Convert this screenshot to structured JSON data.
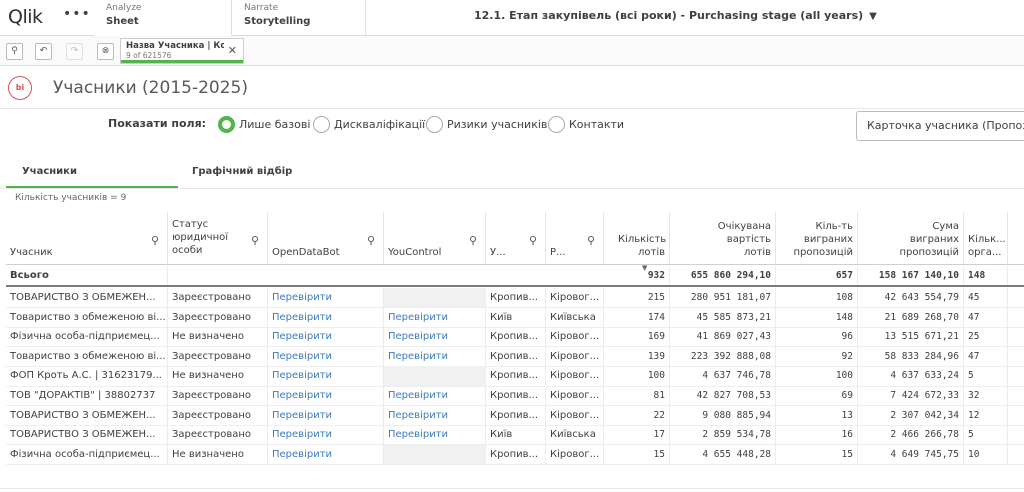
{
  "nav": {
    "logo": "Qlik",
    "tabs": [
      {
        "sub": "Analyze",
        "main": "Sheet"
      },
      {
        "sub": "Narrate",
        "main": "Storytelling"
      }
    ],
    "app_title": "12.1. Етап закупівель (всі роки) - Purchasing stage (all years)"
  },
  "selection": {
    "field": "Назва Учасника | Ко...",
    "count": "9 of 621576"
  },
  "sheet": {
    "logo_text": "bi",
    "title": "Учасники (2015-2025)"
  },
  "fields": {
    "label": "Показати поля:",
    "options": [
      "Лише базові",
      "Дискваліфікації",
      "Ризики учасників",
      "Контакти"
    ],
    "selected": "Лише базові"
  },
  "card_button": "Карточка учасника (Пропози",
  "tabs": [
    "Учасники",
    "Графічний відбір"
  ],
  "participant_count": "Кількість учасників = 9",
  "table": {
    "headers": {
      "participant": "Учасник",
      "status": "Статус юридичної особи",
      "odb": "OpenDataBot",
      "yc": "YouControl",
      "city": "У...",
      "region": "Р...",
      "lots": "Кількість лотів",
      "expected": "Очікувана вартість лотів",
      "won": "Кіль-ть виграних пропозицій",
      "sum": "Сума виграних пропозицій",
      "org": "Кільк... орга..."
    },
    "total": {
      "label": "Всього",
      "lots": "932",
      "expected": "655 860 294,10",
      "won": "657",
      "sum": "158 167 140,10",
      "org": "148"
    },
    "rows": [
      {
        "participant": "ТОВАРИСТВО З ОБМЕЖЕН...",
        "status": "Зареєстровано",
        "odb": "Перевірити",
        "yc": "",
        "city": "Кропив...",
        "region": "Кіровог...",
        "lots": "215",
        "expected": "280 951 181,07",
        "won": "108",
        "sum": "42 643 554,79",
        "org": "45"
      },
      {
        "participant": "Товариство з обмеженою ві...",
        "status": "Зареєстровано",
        "odb": "Перевірити",
        "yc": "Перевірити",
        "city": "Київ",
        "region": "Київська",
        "lots": "174",
        "expected": "45 585 873,21",
        "won": "148",
        "sum": "21 689 268,70",
        "org": "47"
      },
      {
        "participant": "Фізична особа-підприємец...",
        "status": "Не визначено",
        "odb": "Перевірити",
        "yc": "Перевірити",
        "city": "Кропив...",
        "region": "Кіровог...",
        "lots": "169",
        "expected": "41 869 027,43",
        "won": "96",
        "sum": "13 515 671,21",
        "org": "25"
      },
      {
        "participant": "Товариство з обмеженою ві...",
        "status": "Зареєстровано",
        "odb": "Перевірити",
        "yc": "Перевірити",
        "city": "Кропив...",
        "region": "Кіровог...",
        "lots": "139",
        "expected": "223 392 888,08",
        "won": "92",
        "sum": "58 833 284,96",
        "org": "47"
      },
      {
        "participant": "ФОП Кроть А.С. | 31623179...",
        "status": "Не визначено",
        "odb": "Перевірити",
        "yc": "",
        "city": "Кропив...",
        "region": "Кіровог...",
        "lots": "100",
        "expected": "4 637 746,78",
        "won": "100",
        "sum": "4 637 633,24",
        "org": "5"
      },
      {
        "participant": "ТОВ \"ДОРАКТІВ\" | 38802737",
        "status": "Зареєстровано",
        "odb": "Перевірити",
        "yc": "Перевірити",
        "city": "Кропив...",
        "region": "Кіровог...",
        "lots": "81",
        "expected": "42 827 708,53",
        "won": "69",
        "sum": "7 424 672,33",
        "org": "32"
      },
      {
        "participant": "ТОВАРИСТВО З ОБМЕЖЕН...",
        "status": "Зареєстровано",
        "odb": "Перевірити",
        "yc": "Перевірити",
        "city": "Кропив...",
        "region": "Кіровог...",
        "lots": "22",
        "expected": "9 080 885,94",
        "won": "13",
        "sum": "2 307 042,34",
        "org": "12"
      },
      {
        "participant": "ТОВАРИСТВО З ОБМЕЖЕН...",
        "status": "Зареєстровано",
        "odb": "Перевірити",
        "yc": "Перевірити",
        "city": "Київ",
        "region": "Київська",
        "lots": "17",
        "expected": "2 859 534,78",
        "won": "16",
        "sum": "2 466 266,78",
        "org": "5"
      },
      {
        "participant": "Фізична особа-підприємец...",
        "status": "Не визначено",
        "odb": "Перевірити",
        "yc": "",
        "city": "Кропив...",
        "region": "Кіровог...",
        "lots": "15",
        "expected": "4 655 448,28",
        "won": "15",
        "sum": "4 649 745,75",
        "org": "10"
      }
    ]
  }
}
